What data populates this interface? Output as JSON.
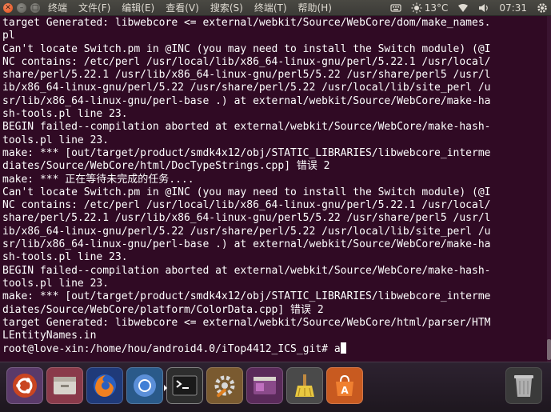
{
  "menubar": {
    "items": [
      "终端",
      "文件(F)",
      "编辑(E)",
      "查看(V)",
      "搜索(S)",
      "终端(T)",
      "帮助(H)"
    ]
  },
  "indicators": {
    "weather": "13°C",
    "time": "07:31"
  },
  "terminal": {
    "lines": [
      "target Generated: libwebcore <= external/webkit/Source/WebCore/dom/make_names.",
      "pl",
      "Can't locate Switch.pm in @INC (you may need to install the Switch module) (@I",
      "NC contains: /etc/perl /usr/local/lib/x86_64-linux-gnu/perl/5.22.1 /usr/local/",
      "share/perl/5.22.1 /usr/lib/x86_64-linux-gnu/perl5/5.22 /usr/share/perl5 /usr/l",
      "ib/x86_64-linux-gnu/perl/5.22 /usr/share/perl/5.22 /usr/local/lib/site_perl /u",
      "sr/lib/x86_64-linux-gnu/perl-base .) at external/webkit/Source/WebCore/make-ha",
      "sh-tools.pl line 23.",
      "BEGIN failed--compilation aborted at external/webkit/Source/WebCore/make-hash-",
      "tools.pl line 23.",
      "make: *** [out/target/product/smdk4x12/obj/STATIC_LIBRARIES/libwebcore_interme",
      "diates/Source/WebCore/html/DocTypeStrings.cpp] 错误 2",
      "make: *** 正在等待未完成的任务....",
      "Can't locate Switch.pm in @INC (you may need to install the Switch module) (@I",
      "NC contains: /etc/perl /usr/local/lib/x86_64-linux-gnu/perl/5.22.1 /usr/local/",
      "share/perl/5.22.1 /usr/lib/x86_64-linux-gnu/perl5/5.22 /usr/share/perl5 /usr/l",
      "ib/x86_64-linux-gnu/perl/5.22 /usr/share/perl/5.22 /usr/local/lib/site_perl /u",
      "sr/lib/x86_64-linux-gnu/perl-base .) at external/webkit/Source/WebCore/make-ha",
      "sh-tools.pl line 23.",
      "BEGIN failed--compilation aborted at external/webkit/Source/WebCore/make-hash-",
      "tools.pl line 23.",
      "make: *** [out/target/product/smdk4x12/obj/STATIC_LIBRARIES/libwebcore_interme",
      "diates/Source/WebCore/platform/ColorData.cpp] 错误 2",
      "target Generated: libwebcore <= external/webkit/Source/WebCore/html/parser/HTM",
      "LEntityNames.in"
    ],
    "prompt": "root@love-xin:/home/hou/android4.0/iTop4412_ICS_git# ",
    "input": "a"
  },
  "launcher": {
    "items": [
      {
        "icon": "ubuntu-dash-icon",
        "bg": "#6b4a7a"
      },
      {
        "icon": "files-icon",
        "bg": "#8a3a4a"
      },
      {
        "icon": "firefox-icon",
        "bg": "#1f4a8a"
      },
      {
        "icon": "chromium-icon",
        "bg": "#2a5a8a"
      },
      {
        "icon": "terminal-icon",
        "bg": "#3a3a3a"
      },
      {
        "icon": "system-settings-icon",
        "bg": "#7a5a30"
      },
      {
        "icon": "workspace-switcher-icon",
        "bg": "#5a2a5a"
      },
      {
        "icon": "bleachbit-icon",
        "bg": "#4a4a4a"
      },
      {
        "icon": "software-center-icon",
        "bg": "#c85a20"
      },
      {
        "icon": "trash-icon",
        "bg": "#3a3a3a"
      }
    ]
  },
  "colors": {
    "terminal_bg": "#300a24",
    "terminal_fg": "#ffffff",
    "close_button": "#df4b16"
  }
}
